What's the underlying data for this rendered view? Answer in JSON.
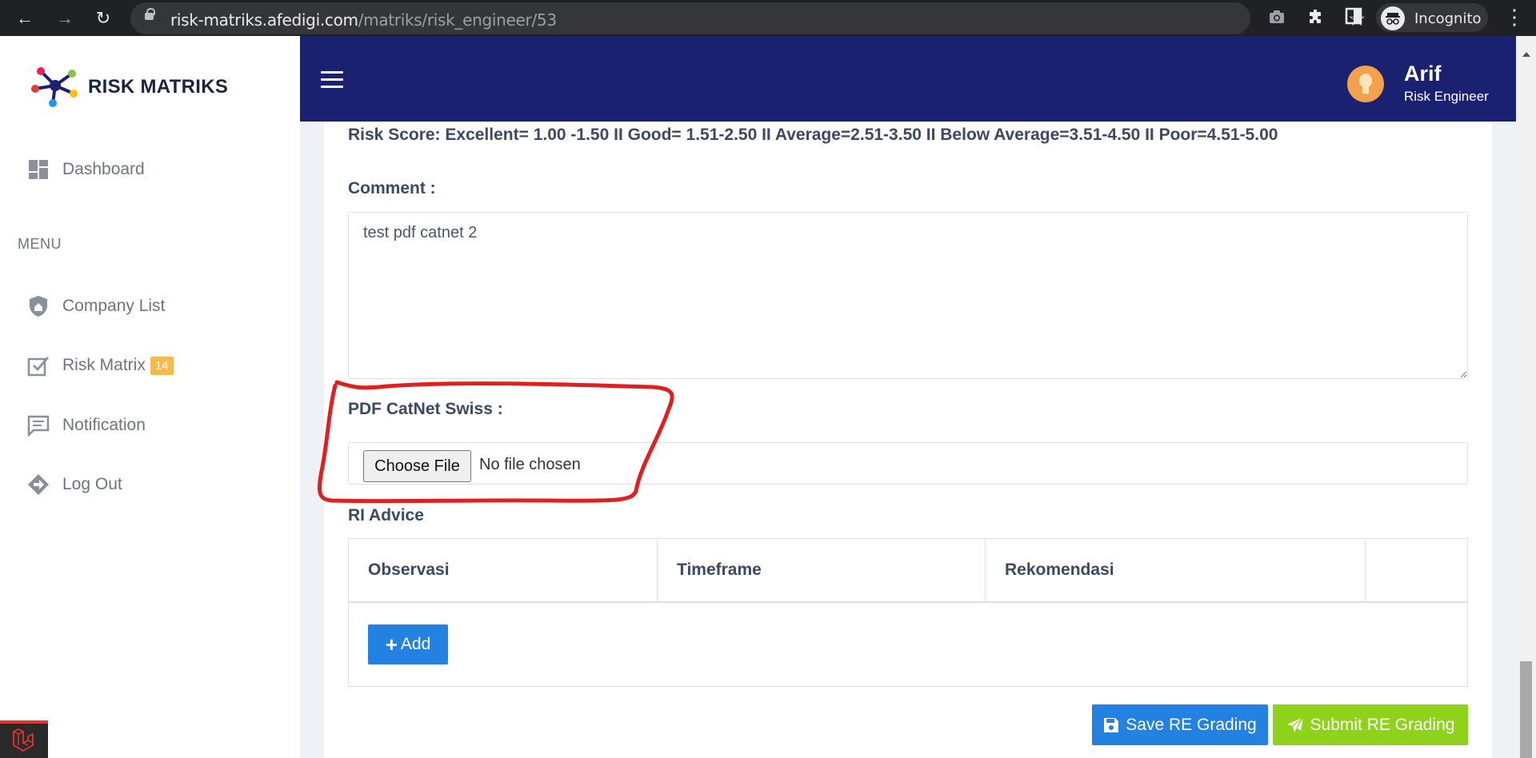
{
  "browser": {
    "url_host": "risk-matriks.afedigi.com",
    "url_path": "/matriks/risk_engineer/53",
    "profile_label": "Incognito",
    "icons": [
      "back-icon",
      "forward-icon",
      "reload-icon",
      "lock-icon",
      "star-icon",
      "camera-icon",
      "extensions-icon",
      "side-panel-icon",
      "incognito-icon",
      "more-icon"
    ]
  },
  "brand": {
    "name": "RISK MATRIKS"
  },
  "sidebar": {
    "menu_label": "MENU",
    "items": [
      {
        "label": "Dashboard",
        "icon": "dashboard-icon"
      },
      {
        "label": "Company List",
        "icon": "shield-home-icon"
      },
      {
        "label": "Risk Matrix",
        "icon": "checkbox-icon",
        "badge": "14"
      },
      {
        "label": "Notification",
        "icon": "message-icon"
      },
      {
        "label": "Log Out",
        "icon": "exit-icon"
      }
    ]
  },
  "user": {
    "name": "Arif",
    "role": "Risk Engineer"
  },
  "form": {
    "risk_score_text": "Risk Score: Excellent= 1.00 -1.50 II Good= 1.51-2.50 II Average=2.51-3.50 II Below Average=3.51-4.50 II Poor=4.51-5.00",
    "comment_label": "Comment :",
    "comment_value": "test pdf catnet 2",
    "pdf_label": "PDF CatNet Swiss :",
    "choose_file_label": "Choose File",
    "no_file_text": "No file chosen",
    "ri_advice_label": "RI Advice",
    "ri_columns": [
      "Observasi",
      "Timeframe",
      "Rekomendasi",
      ""
    ],
    "add_label": "Add",
    "save_label": "Save RE Grading",
    "submit_label": "Submit RE Grading"
  },
  "colors": {
    "navbar": "#1a2171",
    "primary_button": "#2381e1",
    "submit_button": "#8fd21a",
    "badge": "#f6b94b",
    "annotation": "#e02020"
  }
}
